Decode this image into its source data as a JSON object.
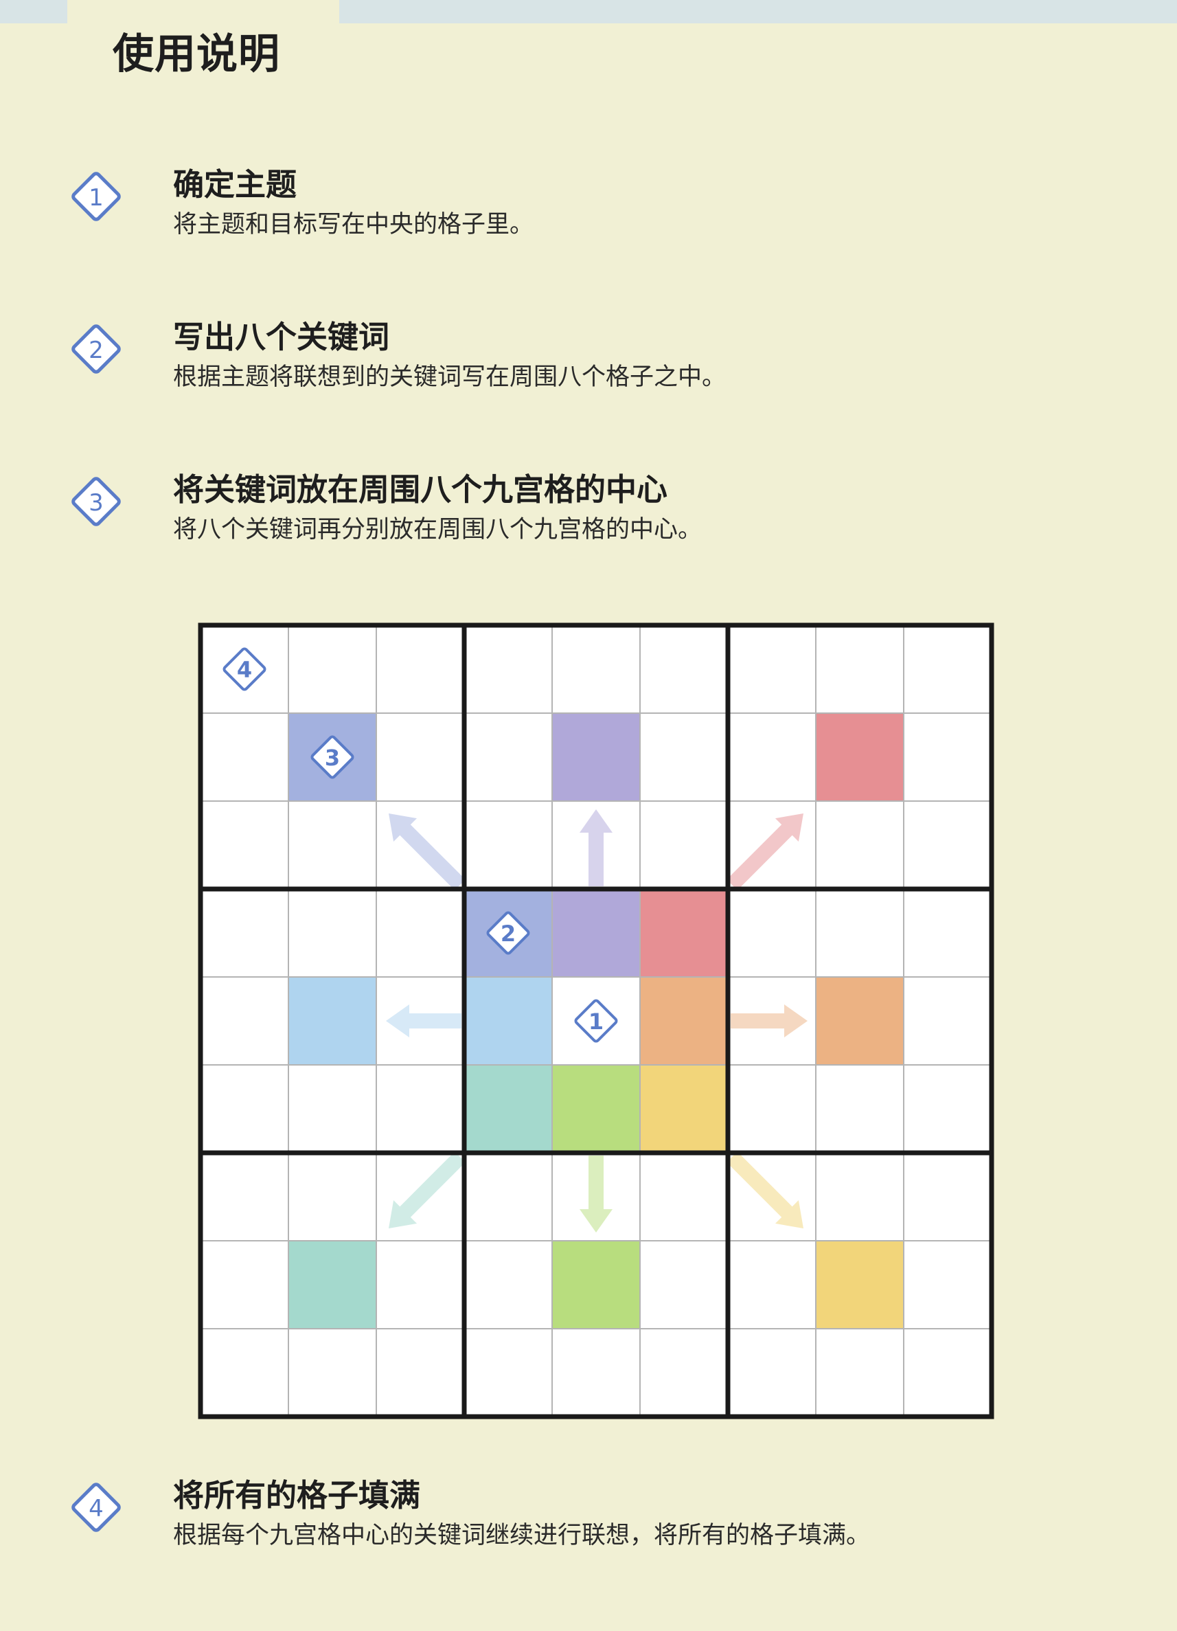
{
  "page": {
    "title": "使用说明"
  },
  "steps": [
    {
      "num": "1",
      "title": "确定主题",
      "desc": "将主题和目标写在中央的格子里。"
    },
    {
      "num": "2",
      "title": "写出八个关键词",
      "desc": "根据主题将联想到的关键词写在周围八个格子之中。"
    },
    {
      "num": "3",
      "title": "将关键词放在周围八个九宫格的中心",
      "desc": "将八个关键词再分别放在周围八个九宫格的中心。"
    },
    {
      "num": "4",
      "title": "将所有的格子填满",
      "desc": "根据每个九宫格中心的关键词继续进行联想，将所有的格子填满。"
    }
  ],
  "diagram": {
    "markers": [
      {
        "label": "4",
        "row": 0,
        "col": 0
      },
      {
        "label": "3",
        "row": 1,
        "col": 1
      },
      {
        "label": "2",
        "row": 3,
        "col": 3
      },
      {
        "label": "1",
        "row": 4,
        "col": 4
      }
    ],
    "colors": {
      "blue": "#a3b1df",
      "purple": "#b0a8d9",
      "red": "#e68f93",
      "sky": "#afd4ef",
      "orange": "#ecb283",
      "teal": "#a4d9cd",
      "green": "#b8dd7e",
      "yellow": "#f2d57a",
      "accent": "#5a7cc8"
    }
  }
}
